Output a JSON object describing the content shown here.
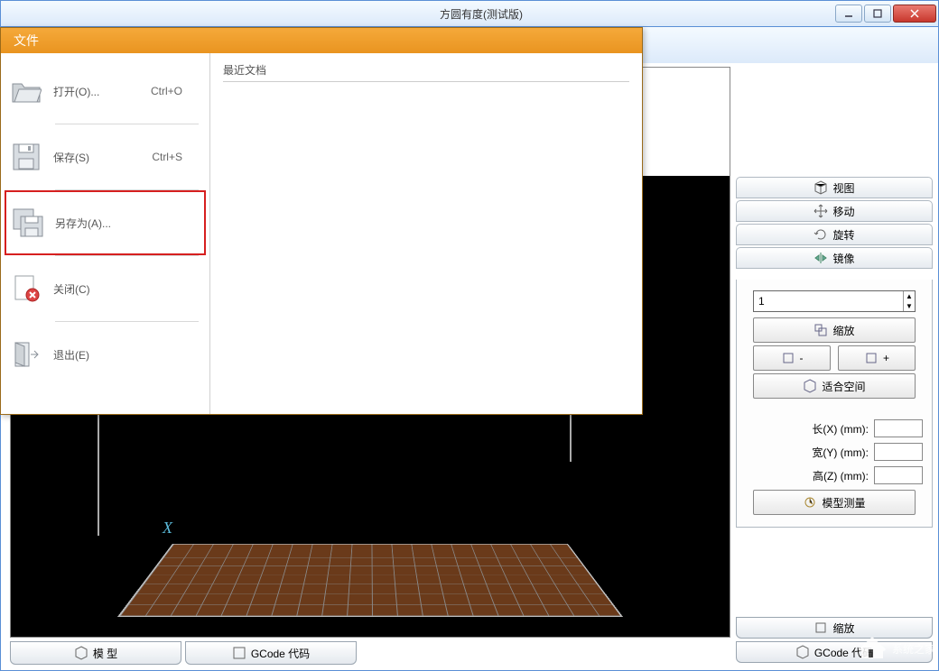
{
  "window": {
    "title": "方圆有度(测试版)"
  },
  "filemenu": {
    "header": "文件",
    "recent_header": "最近文档",
    "items": [
      {
        "label": "打开(O)...",
        "shortcut": "Ctrl+O"
      },
      {
        "label": "保存(S)",
        "shortcut": "Ctrl+S"
      },
      {
        "label": "另存为(A)...",
        "shortcut": ""
      },
      {
        "label": "关闭(C)",
        "shortcut": ""
      },
      {
        "label": "退出(E)",
        "shortcut": ""
      }
    ]
  },
  "right_tabs": {
    "view": "视图",
    "move": "移动",
    "rotate": "旋转",
    "mirror": "镜像"
  },
  "scale_panel": {
    "value": "1",
    "scale_btn": "缩放",
    "fit_btn": "适合空间",
    "length_label": "长(X) (mm):",
    "width_label": "宽(Y) (mm):",
    "height_label": "高(Z) (mm):",
    "measure_btn": "模型测量",
    "minus_label": "-",
    "plus_label": "+"
  },
  "bottom_right_tabs": {
    "scale": "缩放",
    "gcode": "GCode 代码"
  },
  "bottom_tabs": {
    "model": "模 型",
    "gcode": "GCode 代码"
  },
  "axis": {
    "x": "X"
  },
  "watermark": {
    "text": "系统之家"
  }
}
